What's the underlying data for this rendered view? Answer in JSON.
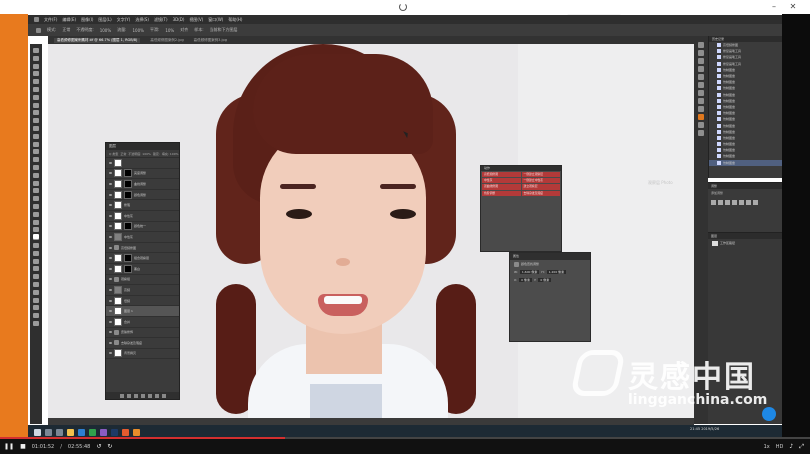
{
  "app": {
    "menu": [
      "文件(F)",
      "编辑(E)",
      "图像(I)",
      "图层(L)",
      "文字(Y)",
      "选择(S)",
      "滤镜(T)",
      "3D(D)",
      "视图(V)",
      "窗口(W)",
      "帮助(H)"
    ],
    "options": [
      "模式:",
      "正常",
      "不透明度:",
      "100%",
      "流量:",
      "100%",
      "平滑:",
      "10%",
      "对齐",
      "样本:",
      "当前和下方图层"
    ],
    "tabs": [
      {
        "label": "高低频修图案例素材.tif @ 66.7% (图层 1, RGB/8)",
        "active": true
      },
      {
        "label": "高低频修图案例2.jpg",
        "active": false
      },
      {
        "label": "高低频修图案例3.jpg",
        "active": false
      }
    ],
    "badge": "• 收藏夹 2019"
  },
  "layers_panel": {
    "title": "图层",
    "controls": [
      "Q 类型",
      "正常",
      "不透明度: 100%",
      "锁定:",
      "填充: 100%"
    ],
    "rows": [
      {
        "label": "",
        "type": "thumb"
      },
      {
        "label": "亮度调整",
        "type": "mask"
      },
      {
        "label": "曲线调整",
        "type": "mask"
      },
      {
        "label": "颜色调整",
        "type": "mask"
      },
      {
        "label": "修瑕",
        "type": "thumb"
      },
      {
        "label": "中性灰",
        "type": "thumb"
      },
      {
        "label": "颜色统一",
        "type": "mask"
      },
      {
        "label": "中性灰",
        "type": "gray"
      },
      {
        "label": "高低频修图",
        "type": "folder"
      },
      {
        "label": "组合观察层",
        "type": "mask"
      },
      {
        "label": "黑白",
        "type": "mask"
      },
      {
        "label": "观察组",
        "type": "folder"
      },
      {
        "label": "高频",
        "type": "gray"
      },
      {
        "label": "低频",
        "type": "thumb"
      },
      {
        "label": "图层 1",
        "type": "thumb",
        "selected": true
      },
      {
        "label": "合并",
        "type": "thumb"
      },
      {
        "label": "皮肤修饰",
        "type": "folder"
      },
      {
        "label": "去除杂发及瑕疵",
        "type": "folder"
      },
      {
        "label": "背景拷贝",
        "type": "thumb"
      }
    ]
  },
  "actions_panel": {
    "title": "动作",
    "items": [
      "高低频修图",
      "一键建立观察层",
      "中性灰",
      "一键建立中性灰",
      "双曲线修图",
      "建立观察层",
      "色阶调整",
      "去除杂发及瑕疵"
    ]
  },
  "properties_panel": {
    "title": "属性",
    "subtitle": "颜色查找调整",
    "lines": [
      {
        "a": "W:",
        "av": "1,600 像素",
        "b": "H:",
        "bv": "1,200 像素"
      },
      {
        "a": "X:",
        "av": "0 像素",
        "b": "Y:",
        "bv": "0 像素"
      }
    ]
  },
  "history_panel": {
    "title": "历史记录",
    "items": [
      "高低频修图",
      "修复画笔工具",
      "修复画笔工具",
      "修复画笔工具",
      "仿制图章",
      "仿制图章",
      "仿制图章",
      "仿制图章",
      "仿制图章",
      "仿制图章",
      "仿制图章",
      "仿制图章",
      "仿制图章",
      "仿制图章",
      "仿制图章",
      "仿制图章",
      "仿制图章",
      "仿制图章",
      "仿制图章",
      "仿制图章"
    ],
    "current_index": 19
  },
  "nav_panel": {
    "title": "调整",
    "subtitle": "添加调整"
  },
  "layers_mini": {
    "title": "图层",
    "items": [
      "工作区路径"
    ]
  },
  "canvas_faint_text": "观察层 Photo",
  "tray": {
    "time": "21:45",
    "date": "2019/5/26"
  },
  "watermark": {
    "cn": "灵感中国",
    "url": "lingganchina.com"
  },
  "video": {
    "current": "01:01:52",
    "duration": "02:55:48",
    "progress": 0.352,
    "speed": "1x",
    "hd": "HD"
  },
  "colors": {
    "accent": "#e87a1e",
    "actions_red": "#b33a39",
    "progress": "#d32f2f"
  }
}
